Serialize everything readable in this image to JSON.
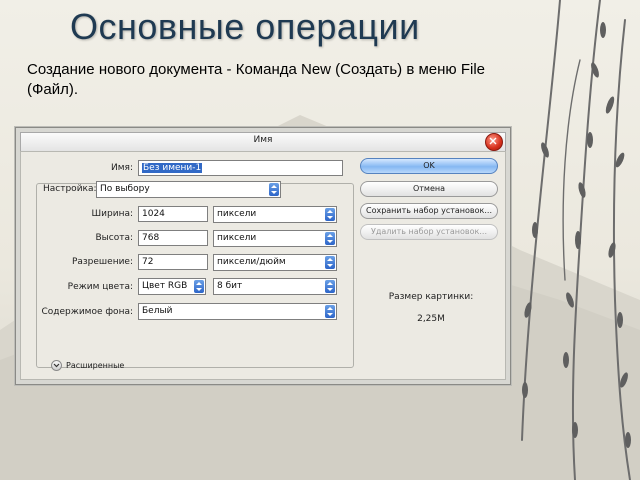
{
  "slide": {
    "title": "Основные операции",
    "description": "Создание нового документа - Команда New (Создать) в меню File (Файл)."
  },
  "dialog": {
    "title": "Имя",
    "fields": {
      "name_label": "Имя:",
      "name_value": "Без имени-1",
      "preset_label": "Настройка:",
      "preset_value": "По выбору",
      "width_label": "Ширина:",
      "width_value": "1024",
      "width_unit": "пиксели",
      "height_label": "Высота:",
      "height_value": "768",
      "height_unit": "пиксели",
      "resolution_label": "Разрешение:",
      "resolution_value": "72",
      "resolution_unit": "пиксели/дюйм",
      "color_mode_label": "Режим цвета:",
      "color_mode_value": "Цвет RGB",
      "bit_depth_value": "8 бит",
      "background_label": "Содержимое фона:",
      "background_value": "Белый",
      "advanced_label": "Расширенные"
    },
    "buttons": {
      "ok": "OK",
      "cancel": "Отмена",
      "save_preset": "Сохранить набор установок...",
      "delete_preset": "Удалить набор установок..."
    },
    "image_size_label": "Размер картинки:",
    "image_size_value": "2,25M"
  },
  "colors": {
    "title_color": "#1f3a52",
    "selection": "#3169c6",
    "ok_button": "#86b8f2",
    "close_button": "#d6301c"
  },
  "icons": [
    "close-icon",
    "dropdown-arrow-icon",
    "expand-icon",
    "branch-decoration"
  ]
}
